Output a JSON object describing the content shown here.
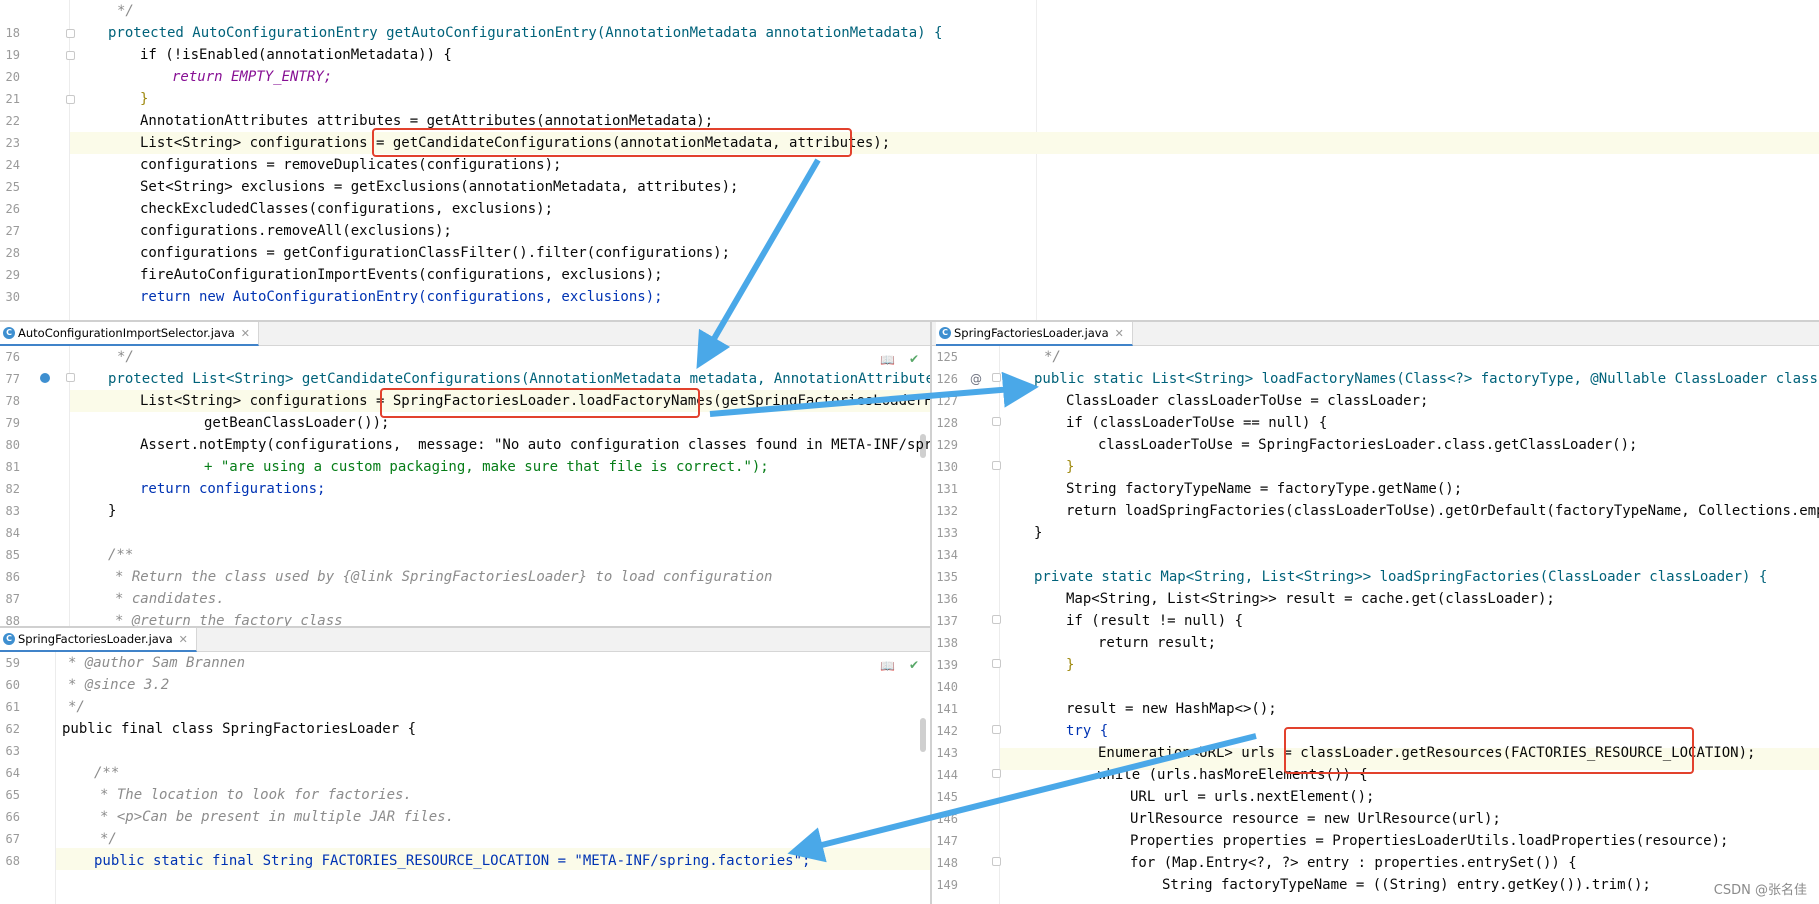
{
  "top_editor": {
    "lines": [
      {
        "n": "",
        "text": "*/"
      },
      {
        "n": "18",
        "text": "protected AutoConfigurationEntry getAutoConfigurationEntry(AnnotationMetadata annotationMetadata) {"
      },
      {
        "n": "19",
        "text": "if (!isEnabled(annotationMetadata)) {"
      },
      {
        "n": "20",
        "text": "return EMPTY_ENTRY;"
      },
      {
        "n": "21",
        "text": "}"
      },
      {
        "n": "22",
        "text": "AnnotationAttributes attributes = getAttributes(annotationMetadata);"
      },
      {
        "n": "23",
        "text": "List<String> configurations = getCandidateConfigurations(annotationMetadata, attributes);"
      },
      {
        "n": "24",
        "text": "configurations = removeDuplicates(configurations);"
      },
      {
        "n": "25",
        "text": "Set<String> exclusions = getExclusions(annotationMetadata, attributes);"
      },
      {
        "n": "26",
        "text": "checkExcludedClasses(configurations, exclusions);"
      },
      {
        "n": "27",
        "text": "configurations.removeAll(exclusions);"
      },
      {
        "n": "28",
        "text": "configurations = getConfigurationClassFilter().filter(configurations);"
      },
      {
        "n": "29",
        "text": "fireAutoConfigurationImportEvents(configurations, exclusions);"
      },
      {
        "n": "30",
        "text": "return new AutoConfigurationEntry(configurations, exclusions);"
      }
    ]
  },
  "mid_editor": {
    "tab_label": "AutoConfigurationImportSelector.java",
    "lines": [
      {
        "n": "76",
        "text": "*/"
      },
      {
        "n": "77",
        "text": "protected List<String> getCandidateConfigurations(AnnotationMetadata metadata, AnnotationAttributes att"
      },
      {
        "n": "78",
        "text": "List<String> configurations = SpringFactoriesLoader.loadFactoryNames(getSpringFactoriesLoaderFactor"
      },
      {
        "n": "79",
        "text": "getBeanClassLoader());"
      },
      {
        "n": "80",
        "text": "Assert.notEmpty(configurations,  message: \"No auto configuration classes found in META-INF/spring.fa"
      },
      {
        "n": "81",
        "text": "+ \"are using a custom packaging, make sure that file is correct.\");"
      },
      {
        "n": "82",
        "text": "return configurations;"
      },
      {
        "n": "83",
        "text": "}"
      },
      {
        "n": "84",
        "text": ""
      },
      {
        "n": "85",
        "text": "/**"
      },
      {
        "n": "86",
        "text": "* Return the class used by {@link SpringFactoriesLoader} to load configuration"
      },
      {
        "n": "87",
        "text": "* candidates."
      },
      {
        "n": "88",
        "text": "* @return the factory class"
      }
    ]
  },
  "bottom_editor": {
    "tab_label": "SpringFactoriesLoader.java",
    "lines": [
      {
        "n": "59",
        "text": "* @author Sam Brannen"
      },
      {
        "n": "60",
        "text": "* @since 3.2"
      },
      {
        "n": "61",
        "text": "*/"
      },
      {
        "n": "62",
        "text": "public final class SpringFactoriesLoader {"
      },
      {
        "n": "63",
        "text": ""
      },
      {
        "n": "64",
        "text": "/**"
      },
      {
        "n": "65",
        "text": "* The location to look for factories."
      },
      {
        "n": "66",
        "text": "* <p>Can be present in multiple JAR files."
      },
      {
        "n": "67",
        "text": "*/"
      },
      {
        "n": "68",
        "text": "public static final String FACTORIES_RESOURCE_LOCATION = \"META-INF/spring.factories\";"
      }
    ]
  },
  "right_editor": {
    "tab_label": "SpringFactoriesLoader.java",
    "lines": [
      {
        "n": "125",
        "text": "*/"
      },
      {
        "n": "126",
        "text": "public static List<String> loadFactoryNames(Class<?> factoryType, @Nullable ClassLoader classLoade"
      },
      {
        "n": "127",
        "text": "ClassLoader classLoaderToUse = classLoader;"
      },
      {
        "n": "128",
        "text": "if (classLoaderToUse == null) {"
      },
      {
        "n": "129",
        "text": "classLoaderToUse = SpringFactoriesLoader.class.getClassLoader();"
      },
      {
        "n": "130",
        "text": "}"
      },
      {
        "n": "131",
        "text": "String factoryTypeName = factoryType.getName();"
      },
      {
        "n": "132",
        "text": "return loadSpringFactories(classLoaderToUse).getOrDefault(factoryTypeName, Collections.emptyLi"
      },
      {
        "n": "133",
        "text": "}"
      },
      {
        "n": "134",
        "text": ""
      },
      {
        "n": "135",
        "text": "private static Map<String, List<String>> loadSpringFactories(ClassLoader classLoader) {"
      },
      {
        "n": "136",
        "text": "Map<String, List<String>> result = cache.get(classLoader);"
      },
      {
        "n": "137",
        "text": "if (result != null) {"
      },
      {
        "n": "138",
        "text": "return result;"
      },
      {
        "n": "139",
        "text": "}"
      },
      {
        "n": "140",
        "text": ""
      },
      {
        "n": "141",
        "text": "result = new HashMap<>();"
      },
      {
        "n": "142",
        "text": "try {"
      },
      {
        "n": "143",
        "text": "Enumeration<URL> urls = classLoader.getResources(FACTORIES_RESOURCE_LOCATION);"
      },
      {
        "n": "144",
        "text": "while (urls.hasMoreElements()) {"
      },
      {
        "n": "145",
        "text": "URL url = urls.nextElement();"
      },
      {
        "n": "146",
        "text": "UrlResource resource = new UrlResource(url);"
      },
      {
        "n": "147",
        "text": "Properties properties = PropertiesLoaderUtils.loadProperties(resource);"
      },
      {
        "n": "148",
        "text": "for (Map.Entry<?, ?> entry : properties.entrySet()) {"
      },
      {
        "n": "149",
        "text": "String factoryTypeName = ((String) entry.getKey()).trim();"
      }
    ]
  },
  "watermark": "CSDN @张名佳",
  "colors": {
    "arrow": "#4aa8e8",
    "highlight_box": "#e2412d",
    "keyword": "#0033b3",
    "method": "#00627a",
    "string": "#067d17",
    "constant": "#871094"
  },
  "icons": {
    "reader_mode": "book-icon",
    "inspection_ok": "check-icon",
    "class_file": "class-c-icon"
  }
}
